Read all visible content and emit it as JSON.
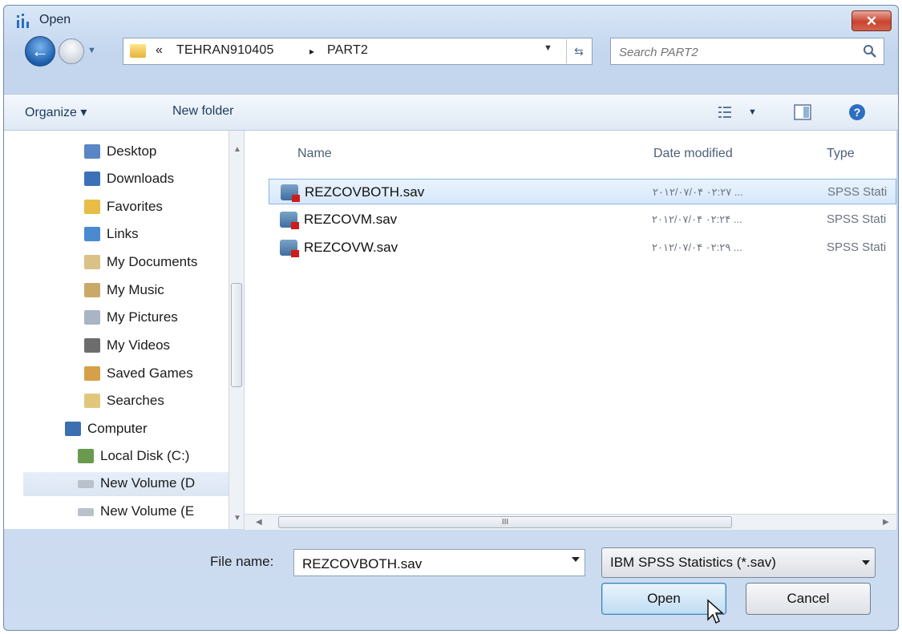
{
  "window": {
    "title": "Open",
    "close_label": "✕"
  },
  "nav": {
    "breadcrumbs": [
      "«",
      "TEHRAN910405",
      "▸",
      "PART2"
    ],
    "search_placeholder": "Search PART2"
  },
  "toolbar": {
    "organize": "Organize ▾",
    "new_folder": "New folder"
  },
  "sidebar": {
    "items": [
      {
        "label": "Desktop",
        "color": "#5b86c5"
      },
      {
        "label": "Downloads",
        "color": "#3c71b8"
      },
      {
        "label": "Favorites",
        "color": "#e8bd45"
      },
      {
        "label": "Links",
        "color": "#4a8ad1"
      },
      {
        "label": "My Documents",
        "color": "#d9c187"
      },
      {
        "label": "My Music",
        "color": "#c9a96a"
      },
      {
        "label": "My Pictures",
        "color": "#a9b5c3"
      },
      {
        "label": "My Videos",
        "color": "#6d6d6d"
      },
      {
        "label": "Saved Games",
        "color": "#d5a04a"
      },
      {
        "label": "Searches",
        "color": "#e1c77d"
      },
      {
        "label": "Computer",
        "color": "#3b6fb0"
      },
      {
        "label": "Local Disk (C:)",
        "color": "#6a9a4e"
      },
      {
        "label": "New Volume (D",
        "color": "#b9c2cc"
      },
      {
        "label": "New Volume (E",
        "color": "#b9c2cc"
      }
    ]
  },
  "files": {
    "columns": {
      "name": "Name",
      "date": "Date modified",
      "type": "Type"
    },
    "rows": [
      {
        "name": "REZCOVBOTH.sav",
        "date": "۲۰۱۲/۰۷/۰۴ ۰۲:۲۷ ...",
        "type": "SPSS Stati"
      },
      {
        "name": "REZCOVM.sav",
        "date": "۲۰۱۲/۰۷/۰۴ ۰۲:۲۴ ...",
        "type": "SPSS Stati"
      },
      {
        "name": "REZCOVW.sav",
        "date": "۲۰۱۲/۰۷/۰۴ ۰۲:۲۹ ...",
        "type": "SPSS Stati"
      }
    ]
  },
  "footer": {
    "filename_label": "File name:",
    "filename_value": "REZCOVBOTH.sav",
    "filter_value": "IBM SPSS Statistics (*.sav)",
    "open_label": "Open",
    "cancel_label": "Cancel"
  },
  "scrollbar_glyph": "III"
}
